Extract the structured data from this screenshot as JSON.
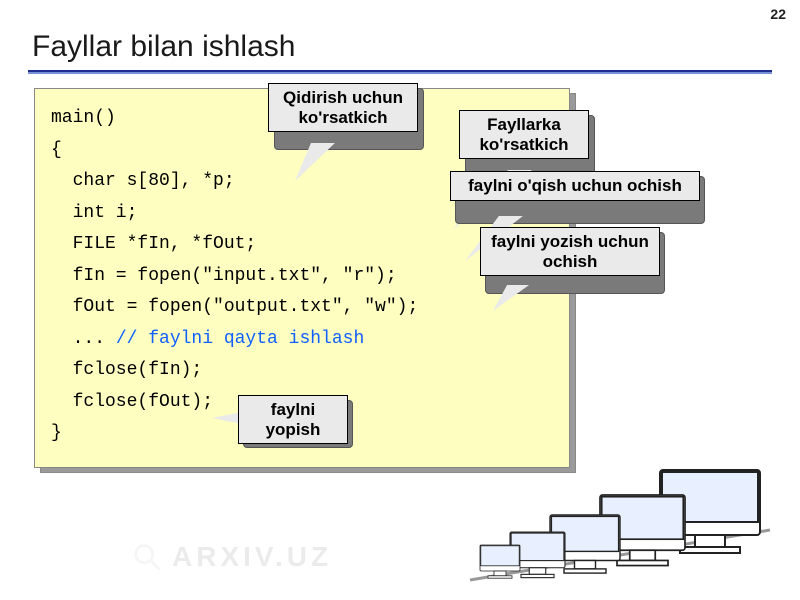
{
  "page_number": "22",
  "title": "Fayllar bilan ishlash",
  "watermark": "ARXIV.UZ",
  "code": {
    "l1": "main()",
    "l2": "{",
    "l3": "  char s[80], *p;",
    "l4": "  int i;",
    "l5": "  FILE *fIn, *fOut;",
    "l6": "  fIn = fopen(\"input.txt\", \"r\");",
    "l7": "  fOut = fopen(\"output.txt\", \"w\");",
    "l8a": "  ... ",
    "l8b": "// faylni qayta ishlash",
    "l9": "  fclose(fIn);",
    "l10": "  fclose(fOut);",
    "l11": "}"
  },
  "callouts": {
    "c1": "Qidirish uchun ko'rsatkich",
    "c2": "Fayllarka ko'rsatkich",
    "c3": "faylni o'qish uchun ochish",
    "c4": "faylni yozish uchun ochish",
    "c5": "faylni yopish"
  }
}
